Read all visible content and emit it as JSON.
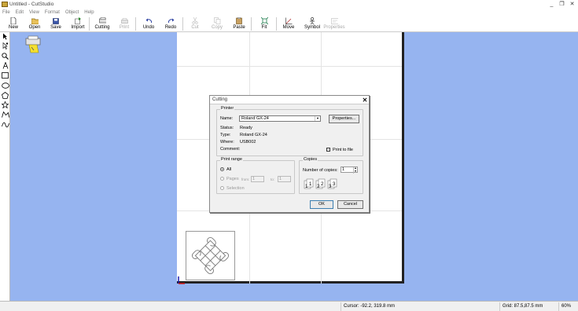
{
  "window": {
    "title": "Untitled - CutStudio",
    "controls": [
      "_",
      "❐",
      "✕"
    ]
  },
  "menu": [
    "File",
    "Edit",
    "View",
    "Format",
    "Object",
    "Help"
  ],
  "toolbar": {
    "new": "New",
    "open": "Open",
    "save": "Save",
    "import": "Import",
    "cutting": "Cutting",
    "print": "Print",
    "undo": "Undo",
    "redo": "Redo",
    "cut": "Cut",
    "copy": "Copy",
    "paste": "Paste",
    "fit": "Fit",
    "move": "Move",
    "symbol": "Symbol",
    "properties": "Properties"
  },
  "tools": [
    "select-arrow-icon",
    "node-edit-icon",
    "zoom-icon",
    "text-icon",
    "rectangle-icon",
    "ellipse-icon",
    "polygon-icon",
    "star-icon",
    "polyline-icon",
    "curve-icon"
  ],
  "dialog": {
    "title": "Cutting",
    "close": "✕",
    "printer": {
      "legend": "Printer",
      "name_label": "Name:",
      "name_value": "Roland GX-24",
      "properties_button": "Properties...",
      "status_label": "Status:",
      "status_value": "Ready",
      "type_label": "Type:",
      "type_value": "Roland GX-24",
      "where_label": "Where:",
      "where_value": "USB002",
      "comment_label": "Comment:",
      "print_to_file": "Print to file"
    },
    "print_range": {
      "legend": "Print range",
      "all": "All",
      "pages": "Pages",
      "from_label": "from:",
      "from_value": "1",
      "to_label": "to:",
      "to_value": "1",
      "selection": "Selection"
    },
    "copies": {
      "legend": "Copies",
      "number_label": "Number of copies:",
      "number_value": "1"
    },
    "ok": "OK",
    "cancel": "Cancel"
  },
  "statusbar": {
    "cursor": "Cursor: -92.2, 319.8 mm",
    "grid": "Grid: 87.5,87.5 mm",
    "zoom": "60%"
  },
  "colors": {
    "workspace": "#96b4f0",
    "paper": "#ffffff",
    "dialog": "#f0f0f0"
  }
}
